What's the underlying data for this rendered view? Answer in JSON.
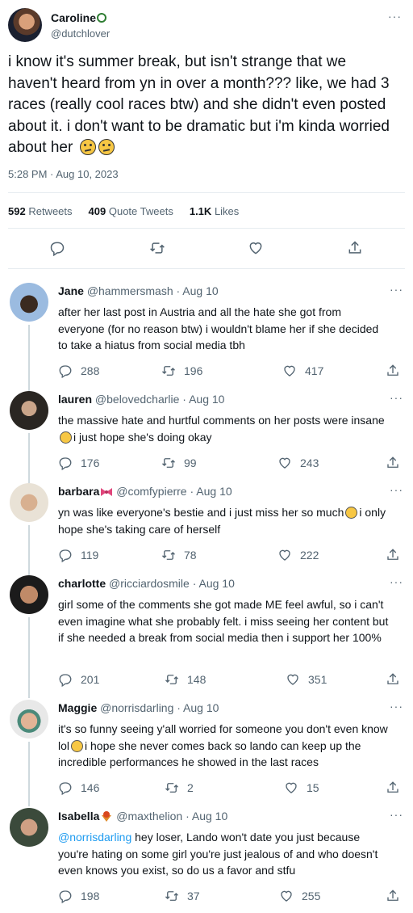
{
  "main": {
    "name": "Caroline",
    "handle": "@dutchlover",
    "text": "i know it's summer break, but isn't strange that we haven't heard from yn in over a month??? like, we had 3 races (really cool races btw) and she didn't even posted about it. i don't want to be dramatic but i'm kinda worried about her",
    "timestamp": "5:28 PM · Aug 10, 2023",
    "retweets_count": "592",
    "retweets_label": "Retweets",
    "quotes_count": "409",
    "quotes_label": "Quote Tweets",
    "likes_count": "1.1K",
    "likes_label": "Likes",
    "more": "···"
  },
  "replies": [
    {
      "name": "Jane",
      "handle": "@hammersmash",
      "date": "· Aug 10",
      "text": "after her last post in Austria and all the hate she got from everyone (for no reason btw) i wouldn't blame her if she decided to take a hiatus from social media tbh",
      "replies": "288",
      "retweets": "196",
      "likes": "417"
    },
    {
      "name": "lauren",
      "handle": "@belovedcharlie",
      "date": "· Aug 10",
      "text": "the massive hate and hurtful comments on her posts were insane",
      "text2": "i just hope she's doing okay",
      "replies": "176",
      "retweets": "99",
      "likes": "243"
    },
    {
      "name": "barbara",
      "handle": "@comfypierre",
      "date": "· Aug 10",
      "text": "yn was like everyone's bestie and i just miss her so much",
      "text2": "i only hope she's taking care of herself",
      "replies": "119",
      "retweets": "78",
      "likes": "222"
    },
    {
      "name": "charlotte",
      "handle": "@ricciardosmile",
      "date": "· Aug 10",
      "text": "girl some of the comments she got made ME feel awful, so i can't even imagine what she probably felt. i miss seeing her content but if she needed a break from social media then i support her 100%",
      "replies": "201",
      "retweets": "148",
      "likes": "351"
    },
    {
      "name": "Maggie",
      "handle": "@norrisdarling",
      "date": "· Aug 10",
      "text": "it's so funny seeing y'all worried for someone you don't even know lol",
      "text2": "i hope she never comes back so lando can keep up the incredible performances he showed in the last races",
      "replies": "146",
      "retweets": "2",
      "likes": "15"
    },
    {
      "name": "Isabella",
      "handle": "@maxthelion",
      "date": "· Aug 10",
      "mention": "@norrisdarling",
      "text": "hey loser, Lando won't date you just because you're hating on some girl you're just jealous of and who doesn't even knows you exist, so do us a favor and stfu",
      "replies": "198",
      "retweets": "37",
      "likes": "255"
    }
  ],
  "icons": {
    "reply": "reply-icon",
    "retweet": "retweet-icon",
    "like": "heart-icon",
    "share": "share-icon",
    "more": "more-icon"
  },
  "colors": {
    "accent": "#1d9bf0",
    "secondary_text": "#536471",
    "divider": "#e6ecf0"
  }
}
